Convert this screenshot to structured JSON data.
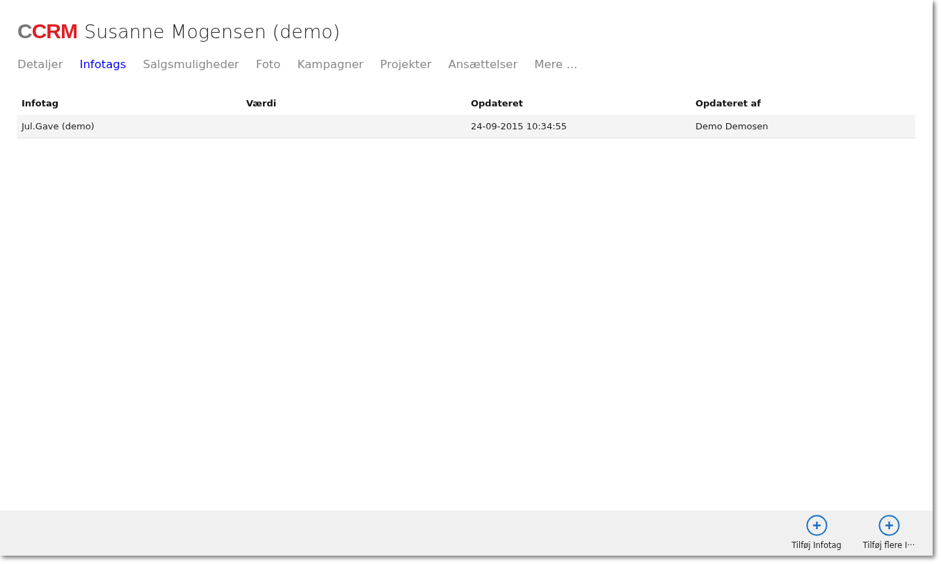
{
  "header": {
    "logo": [
      "C",
      "CRM"
    ],
    "title": "Susanne Mogensen (demo)"
  },
  "tabs": [
    {
      "label": "Detaljer",
      "selected": false
    },
    {
      "label": "Infotags",
      "selected": true
    },
    {
      "label": "Salgsmuligheder",
      "selected": false
    },
    {
      "label": "Foto",
      "selected": false
    },
    {
      "label": "Kampagner",
      "selected": false
    },
    {
      "label": "Projekter",
      "selected": false
    },
    {
      "label": "Ansættelser",
      "selected": false
    },
    {
      "label": "Mere ...",
      "selected": false
    }
  ],
  "table": {
    "columns": [
      "Infotag",
      "Værdi",
      "Opdateret",
      "Opdateret af"
    ],
    "rows": [
      [
        "Jul.Gave (demo)",
        "",
        "24-09-2015 10:34:55",
        "Demo Demosen"
      ]
    ]
  },
  "app_bar": {
    "buttons": [
      "Tilføj Infotag",
      "Tilføj flere I···"
    ]
  }
}
